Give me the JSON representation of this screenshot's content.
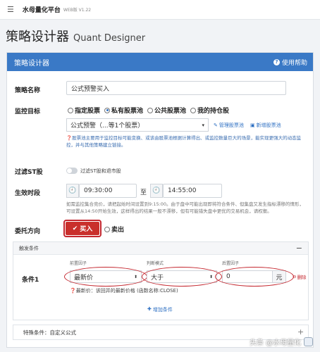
{
  "topbar": {
    "menu_icon": "hamburger-icon",
    "brand": "水母量化平台",
    "version": "WEB版 V1.22"
  },
  "page": {
    "title": "策略设计器",
    "subtitle": "Quant Designer"
  },
  "panel": {
    "title": "策略设计器",
    "help_label": "使用帮助",
    "help_icon": "question-circle-icon"
  },
  "strategy_name": {
    "label": "策略名称",
    "value": "公式预警买入"
  },
  "monitor": {
    "label": "监控目标",
    "options": [
      "指定股票",
      "私有股票池",
      "公共股票池",
      "我的持仓股"
    ],
    "selected": "私有股票池",
    "pool_value": "公式预警（...等1个股票）",
    "manage_link": "管理股票池",
    "new_link": "新增股票池",
    "hint": "股票池主要用于监控目标可能变换、或该由股票池根据计算得出、或监控数量巨大的场景，能实现更强大的动态监控，并与其他策略建立链接。"
  },
  "st_filter": {
    "label": "过滤ST股",
    "toggle_text": "过滤ST股和退市股"
  },
  "effective": {
    "label": "生效时段",
    "start": "09:30:00",
    "separator": "至",
    "end": "14:55:00",
    "hint": "如需监控集合竞价，请把起始时间设置到9:15:00。由于盘中可能出现即将符合条件、但集盘又发生指标漂移的情形，可设置从14:50开始生效，这样得出的结果一般不漂移，但有可能错失盘中更优的交易机会，请权衡。"
  },
  "direction": {
    "label": "委托方向",
    "buy": "买入",
    "sell": "卖出"
  },
  "trigger": {
    "title": "触发条件",
    "collapse": "−",
    "condition_label": "条件1",
    "cap_left": "前置因子",
    "cap_mode": "判断模式",
    "cap_right": "后置因子",
    "left_value": "最新价",
    "mode_value": "大于",
    "right_value": "0",
    "unit": "元",
    "delete": "删除",
    "note": "最新价：该回并的最新价格 (函数名称:CLOSE)",
    "add": "增加条件"
  },
  "special": {
    "label": "特殊条件：自定义公式"
  },
  "watermark": {
    "text": "头条 @水母量化"
  },
  "colors": {
    "primary": "#3a79c6",
    "buy": "#c9302c",
    "highlight": "#c4262e"
  }
}
